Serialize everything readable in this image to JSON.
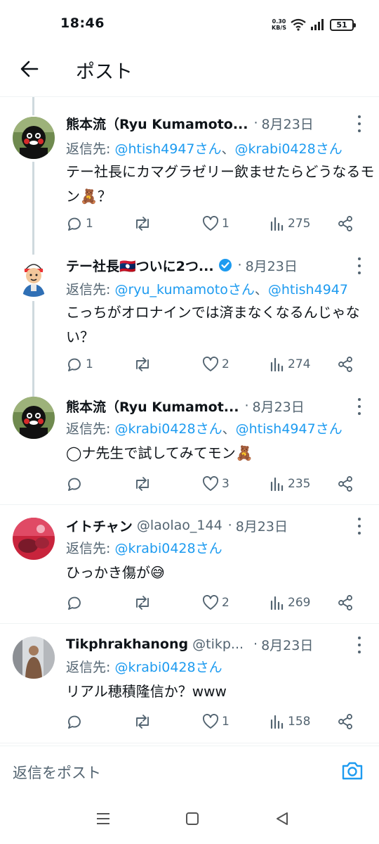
{
  "status_bar": {
    "time": "18:46",
    "net_speed_value": "0.30",
    "net_speed_unit": "KB/S",
    "battery": "51"
  },
  "header": {
    "title": "ポスト"
  },
  "reply_prefix": "返信先: ",
  "posts": [
    {
      "name": "熊本流（Ryu Kumamoto...",
      "handle": "",
      "date": "8月23日",
      "mention_1": "@htish4947さん",
      "separator": "、",
      "mention_2": "@krabi0428さん",
      "text": "テー社長にカマグラゼリー飲ませたらどうなるモン🧸？",
      "replies": "1",
      "reposts": "",
      "likes": "1",
      "views": "275"
    },
    {
      "name": "テー社長🇱🇦ついに2つ...",
      "handle": "",
      "date": "8月23日",
      "mention_1": "@ryu_kumamotoさん",
      "separator": "、",
      "mention_2": "@htish4947",
      "text": "こっちがオロナインでは済まなくなるんじゃない？",
      "replies": "1",
      "reposts": "",
      "likes": "2",
      "views": "274"
    },
    {
      "name": "熊本流（Ryu Kumamot...",
      "handle": "",
      "date": "8月23日",
      "mention_1": "@krabi0428さん",
      "separator": "、",
      "mention_2": "@htish4947さん",
      "text": "◯ナ先生で試してみてモン🧸",
      "replies": "",
      "reposts": "",
      "likes": "3",
      "views": "235"
    },
    {
      "name": "イトチャン",
      "handle": "@laolao_144",
      "date": "8月23日",
      "mention_1": "@krabi0428さん",
      "separator": "",
      "mention_2": "",
      "text": "ひっかき傷が😅",
      "replies": "",
      "reposts": "",
      "likes": "2",
      "views": "269"
    },
    {
      "name": "Tikphrakhanong",
      "handle": "@tikp...",
      "date": "8月23日",
      "mention_1": "@krabi0428さん",
      "separator": "",
      "mention_2": "",
      "text": "リアル穂積隆信か？www",
      "replies": "",
      "reposts": "",
      "likes": "1",
      "views": "158"
    }
  ],
  "composer": {
    "placeholder": "返信をポスト"
  },
  "colors": {
    "accent": "#1d9bf0",
    "secondary_text": "#536471",
    "verified": "#1d9bf0"
  },
  "icons": {
    "back": "arrow-left-icon",
    "reply": "speech-bubble-icon",
    "repost": "repost-arrows-icon",
    "like": "heart-icon",
    "views": "bar-chart-icon",
    "share": "share-nodes-icon",
    "camera": "camera-icon",
    "more": "vertical-dots-icon"
  }
}
